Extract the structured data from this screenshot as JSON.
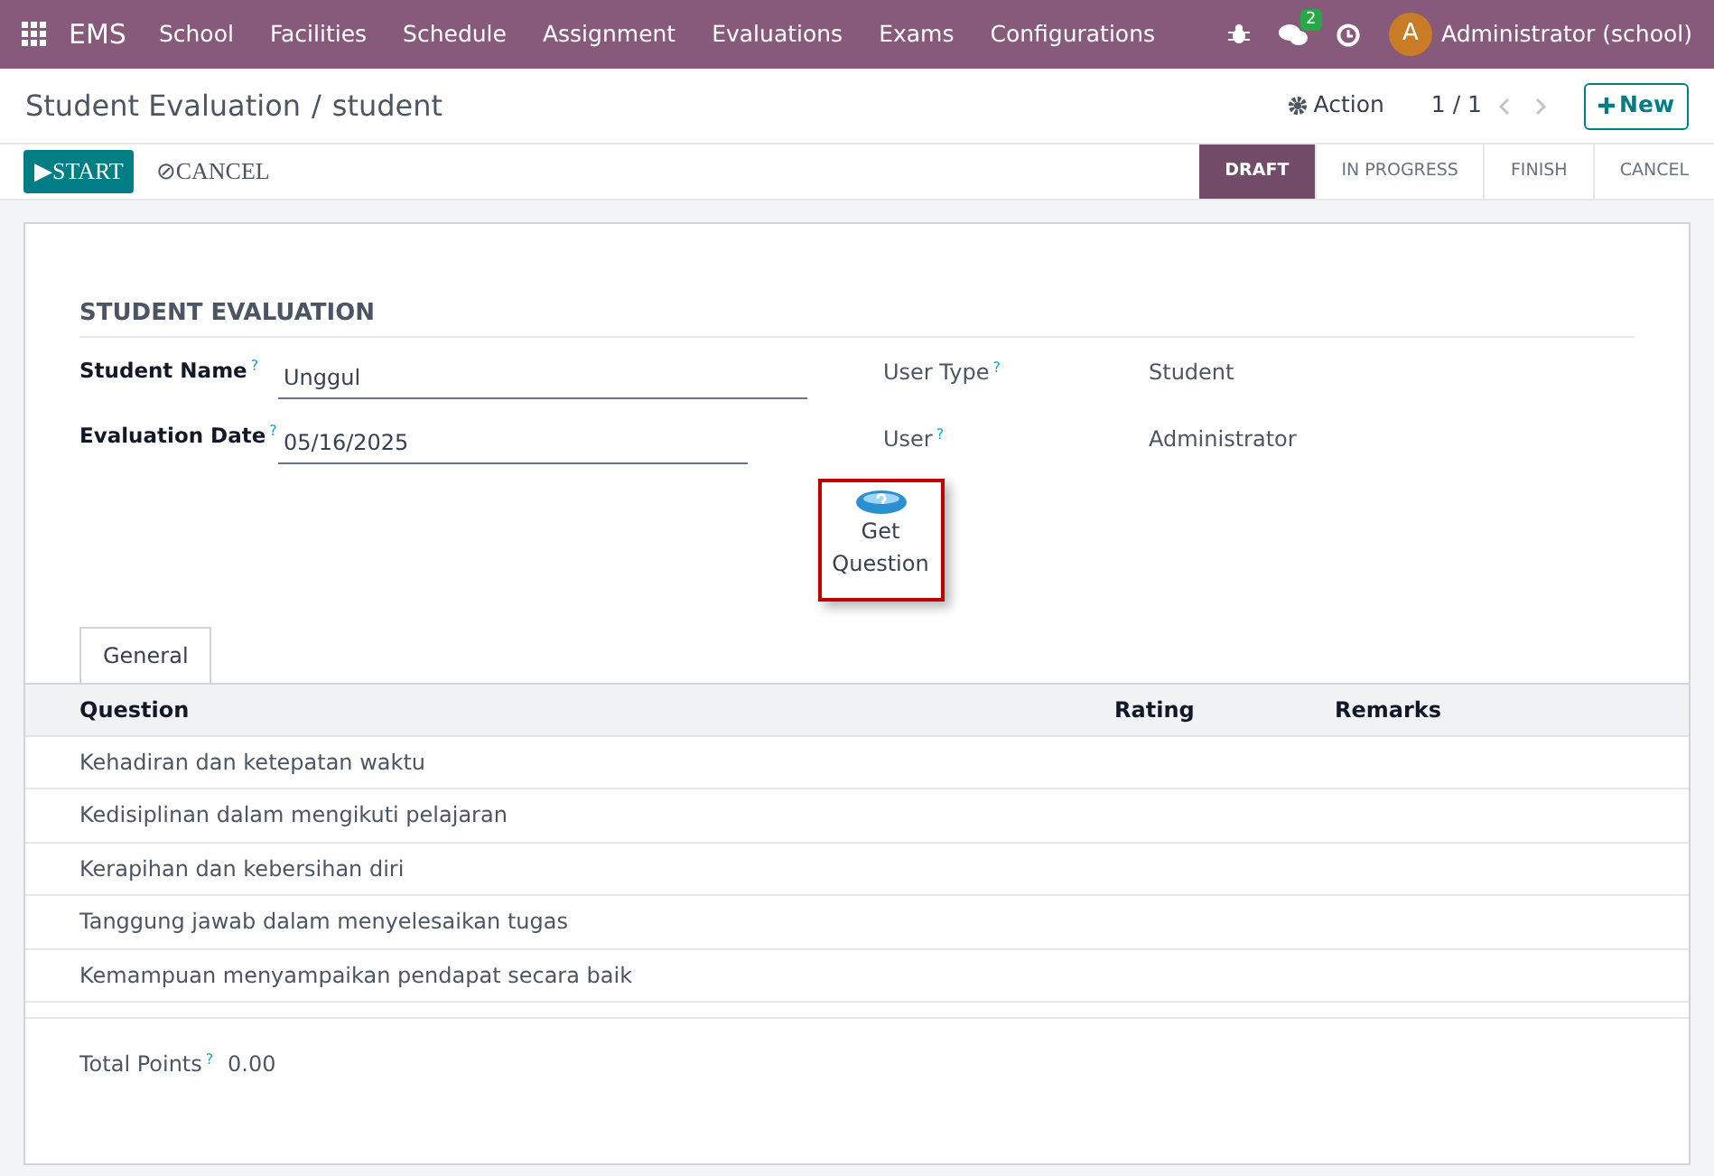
{
  "navbar": {
    "app": "EMS",
    "menus": [
      "School",
      "Facilities",
      "Schedule",
      "Assignment",
      "Evaluations",
      "Exams",
      "Configurations"
    ],
    "message_count": "2",
    "avatar_letter": "A",
    "user": "Administrator (school)"
  },
  "breadcrumb": {
    "parent": "Student Evaluation",
    "separator": "/",
    "current": "student"
  },
  "action": "Action",
  "pager": "1 / 1",
  "new_button": "New",
  "header_buttons": [
    {
      "kind": "primary",
      "icon": "▶",
      "label": "START"
    },
    {
      "kind": "link",
      "icon": "⊘",
      "label": "CANCEL"
    }
  ],
  "status_steps": [
    {
      "label": "DRAFT",
      "selected": true
    },
    {
      "label": "IN PROGRESS",
      "selected": false
    },
    {
      "label": "FINISH",
      "selected": false
    },
    {
      "label": "CANCEL",
      "selected": false
    }
  ],
  "form": {
    "title": "STUDENT EVALUATION",
    "left_fields": [
      {
        "label": "Student Name$^{?}$",
        "value": "Unggul"
      },
      {
        "label": "Evaluation Date$^{?}$",
        "value": "05/16/2025"
      }
    ],
    "right_fields": [
      {
        "label": "User Type$^{?}$",
        "value": "Student"
      },
      {
        "label": "User$^{?}$",
        "value": "Administrator"
      }
    ],
    "get_question": [
      "Get",
      "Question"
    ],
    "tabs": [
      {
        "label": "General",
        "selected": true
      }
    ],
    "table": {
      "columns": [
        "Question",
        "Rating",
        "Remarks"
      ],
      "rows": [
        [
          "Kehadiran dan ketepatan waktu"
        ],
        [
          "Kedisiplinan dalam mengikuti pelajaran"
        ],
        [
          "Kerapihan dan kebersihan diri"
        ],
        [
          "Tanggung jawab dalam menyelesaikan tugas"
        ],
        [
          "Kemampuan menyampaikan pendapat secara baik"
        ]
      ]
    },
    "total": {
      "label": "Total Points$^{?}$",
      "value": "0.00"
    }
  }
}
